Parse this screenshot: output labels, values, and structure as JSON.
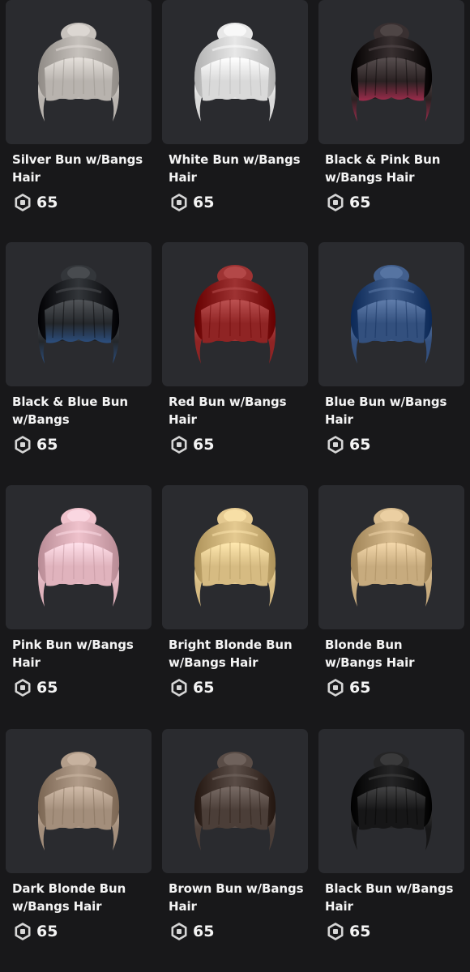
{
  "catalog": {
    "items": [
      {
        "name": "Silver Bun w/Bangs Hair",
        "price": "65",
        "icon": "robux-icon",
        "hair_color": "#b8b3ae",
        "accent_color": "#b8b3ae"
      },
      {
        "name": "White Bun w/Bangs Hair",
        "price": "65",
        "icon": "robux-icon",
        "hair_color": "#d9d9d9",
        "accent_color": "#d9d9d9"
      },
      {
        "name": "Black & Pink Bun w/Bangs Hair",
        "price": "65",
        "icon": "robux-icon",
        "hair_color": "#2a2122",
        "accent_color": "#9e2c4c"
      },
      {
        "name": "Black & Blue Bun w/Bangs",
        "price": "65",
        "icon": "robux-icon",
        "hair_color": "#24272b",
        "accent_color": "#2c4f80"
      },
      {
        "name": "Red Bun w/Bangs Hair",
        "price": "65",
        "icon": "robux-icon",
        "hair_color": "#8f2424",
        "accent_color": "#8f2424"
      },
      {
        "name": "Blue Bun w/Bangs Hair",
        "price": "65",
        "icon": "robux-icon",
        "hair_color": "#33507e",
        "accent_color": "#33507e"
      },
      {
        "name": "Pink Bun w/Bangs Hair",
        "price": "65",
        "icon": "robux-icon",
        "hair_color": "#e0b3bd",
        "accent_color": "#e0b3bd"
      },
      {
        "name": "Bright Blonde Bun w/Bangs Hair",
        "price": "65",
        "icon": "robux-icon",
        "hair_color": "#d6bb82",
        "accent_color": "#d6bb82"
      },
      {
        "name": "Blonde Bun w/Bangs Hair",
        "price": "65",
        "icon": "robux-icon",
        "hair_color": "#c7ab7e",
        "accent_color": "#c7ab7e"
      },
      {
        "name": "Dark Blonde Bun w/Bangs Hair",
        "price": "65",
        "icon": "robux-icon",
        "hair_color": "#a38e7b",
        "accent_color": "#a38e7b"
      },
      {
        "name": "Brown Bun w/Bangs Hair",
        "price": "65",
        "icon": "robux-icon",
        "hair_color": "#4b3e38",
        "accent_color": "#4b3e38"
      },
      {
        "name": "Black Bun w/Bangs Hair",
        "price": "65",
        "icon": "robux-icon",
        "hair_color": "#161617",
        "accent_color": "#161617"
      }
    ]
  }
}
